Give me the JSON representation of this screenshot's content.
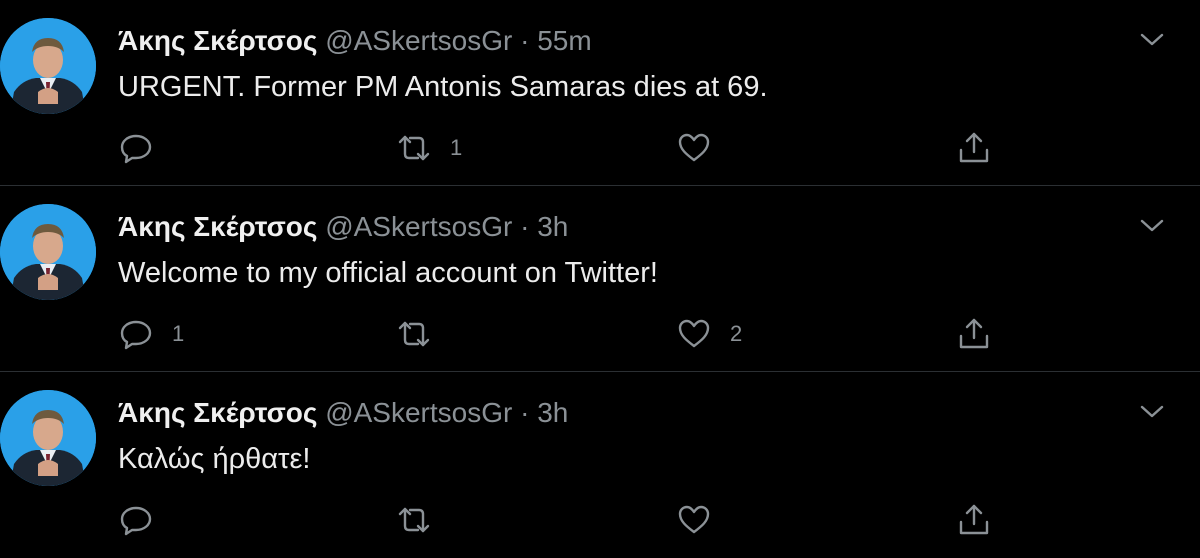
{
  "tweets": [
    {
      "name": "Άκης Σκέρτσος",
      "handle": "@ASkertsosGr",
      "separator": "·",
      "time": "55m",
      "text": "URGENT. Former PM Antonis Samaras dies at 69.",
      "reply_count": "",
      "retweet_count": "1",
      "like_count": ""
    },
    {
      "name": "Άκης Σκέρτσος",
      "handle": "@ASkertsosGr",
      "separator": "·",
      "time": "3h",
      "text": "Welcome to my official account on Twitter!",
      "reply_count": "1",
      "retweet_count": "",
      "like_count": "2"
    },
    {
      "name": "Άκης Σκέρτσος",
      "handle": "@ASkertsosGr",
      "separator": "·",
      "time": "3h",
      "text": "Καλώς ήρθατε!",
      "reply_count": "",
      "retweet_count": "",
      "like_count": ""
    }
  ],
  "icons": {
    "reply": "reply-icon",
    "retweet": "retweet-icon",
    "like": "heart-icon",
    "share": "share-icon",
    "menu": "chevron-down-icon"
  },
  "colors": {
    "background": "#000000",
    "text": "#ececec",
    "muted": "#8b9196",
    "divider": "#2b2f33",
    "avatar_bg": "#1d9bf0"
  }
}
